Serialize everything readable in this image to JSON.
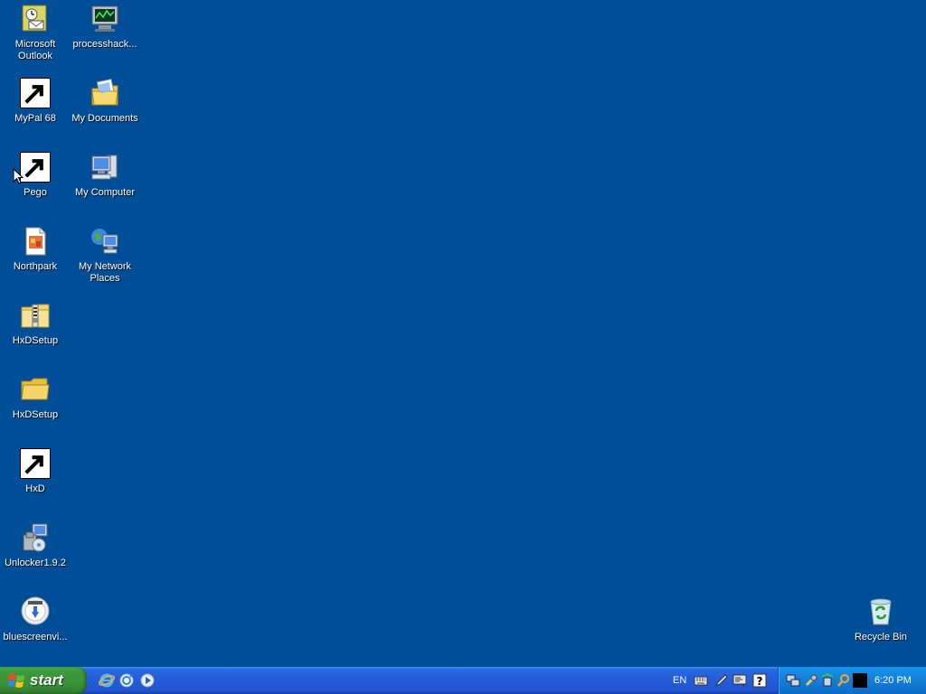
{
  "desktop": {
    "icons": [
      {
        "label": "Microsoft Outlook",
        "icon": "outlook-icon"
      },
      {
        "label": "processhack...",
        "icon": "process-hacker-icon"
      },
      {
        "label": "MyPal 68",
        "icon": "mypal-icon",
        "shortcut": true
      },
      {
        "label": "My Documents",
        "icon": "my-documents-icon"
      },
      {
        "label": "Pego",
        "icon": "pego-icon",
        "shortcut": true
      },
      {
        "label": "My Computer",
        "icon": "my-computer-icon"
      },
      {
        "label": "Northpark",
        "icon": "northpark-icon"
      },
      {
        "label": "My Network Places",
        "icon": "network-places-icon"
      },
      {
        "label": "HxDSetup",
        "icon": "zip-folder-icon"
      },
      {
        "label": "HxDSetup",
        "icon": "folder-icon"
      },
      {
        "label": "HxD",
        "icon": "hxd-icon",
        "shortcut": true
      },
      {
        "label": "Unlocker1.9.2",
        "icon": "installer-icon"
      },
      {
        "label": "bluescreenvi...",
        "icon": "bluescreenview-icon"
      },
      {
        "label": "Recycle Bin",
        "icon": "recycle-bin-icon"
      }
    ]
  },
  "taskbar": {
    "start_label": "start",
    "quick_launch": [
      "internet-explorer-icon",
      "outlook-express-icon",
      "media-player-icon"
    ],
    "language": "EN",
    "toolbar_icons": [
      "keyboard-icon",
      "pen-icon",
      "language-bar-icon",
      "help-icon"
    ],
    "tray_icons": [
      "network-icon",
      "tool-icon",
      "safely-remove-icon",
      "search-icon",
      "console-icon"
    ],
    "clock": "6:20 PM"
  },
  "colors": {
    "desktop_background": "#004e98",
    "taskbar_blue": "#245edb",
    "start_green": "#3c9a3c",
    "tray_blue": "#137ed8"
  }
}
